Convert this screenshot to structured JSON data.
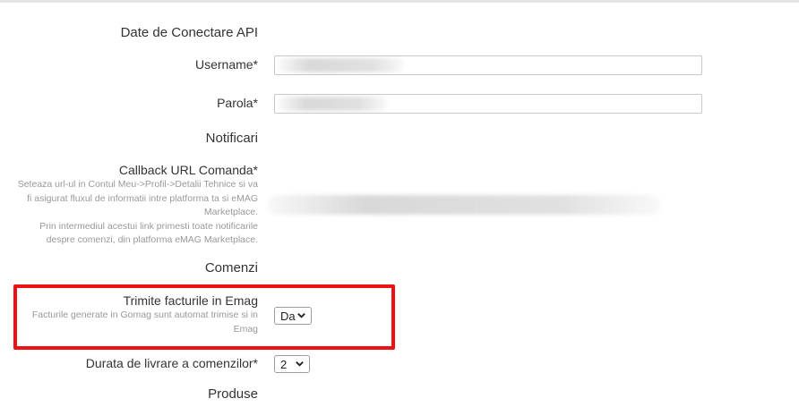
{
  "sections": {
    "api": "Date de Conectare API",
    "notifications": "Notificari",
    "orders": "Comenzi",
    "products": "Produse"
  },
  "fields": {
    "username": {
      "label": "Username*",
      "value": ""
    },
    "password": {
      "label": "Parola*",
      "value": ""
    },
    "callback": {
      "label": "Callback URL Comanda*",
      "help1": "Seteaza url-ul in Contul Meu->Profil->Detalii Tehnice si va fi asigurat fluxul de informatii intre platforma ta si eMAG Marketplace.",
      "help2": "Prin intermediul acestui link primesti toate notificarile despre comenzi, din platforma eMAG Marketplace."
    },
    "send_invoices": {
      "label": "Trimite facturile in Emag",
      "help": "Facturile generate in Gomag sunt automat trimise si in Emag",
      "selected": "Da"
    },
    "delivery_duration": {
      "label": "Durata de livrare a comenzilor*",
      "selected": "2"
    }
  },
  "colors": {
    "highlight": "#ee1111",
    "help_text": "#999999",
    "label_text": "#333333"
  },
  "icons": {
    "select_arrow": "chevron-down-icon"
  }
}
